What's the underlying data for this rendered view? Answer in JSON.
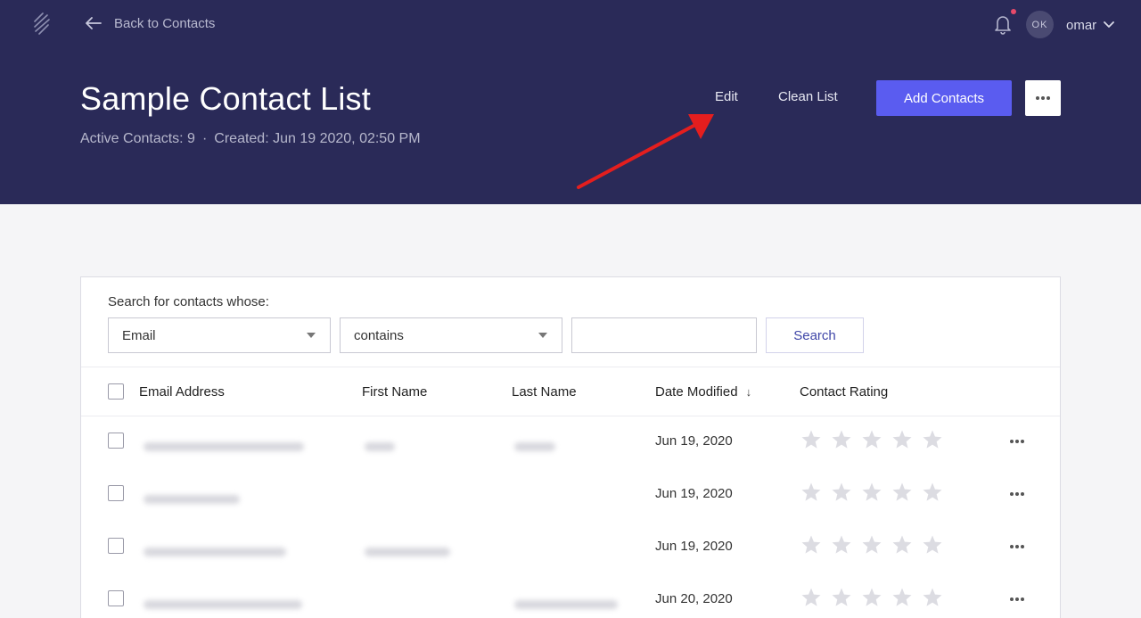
{
  "nav": {
    "back_label": "Back to Contacts",
    "avatar_initials": "OK",
    "username": "omar",
    "has_notification": true
  },
  "list": {
    "title": "Sample Contact List",
    "active_contacts": "Active Contacts: 9",
    "separator": "·",
    "created": "Created: Jun 19 2020, 02:50 PM"
  },
  "actions": {
    "edit_label": "Edit",
    "clean_label": "Clean List",
    "add_label": "Add Contacts"
  },
  "search": {
    "label": "Search for contacts whose:",
    "field_value": "Email",
    "operator_value": "contains",
    "query_value": "",
    "button_label": "Search"
  },
  "table": {
    "columns": [
      "Email Address",
      "First Name",
      "Last Name",
      "Date Modified",
      "Contact Rating"
    ],
    "sort_indicator": "↓",
    "rows": [
      {
        "date": "Jun 19, 2020",
        "rating": 0
      },
      {
        "date": "Jun 19, 2020",
        "rating": 0
      },
      {
        "date": "Jun 19, 2020",
        "rating": 0
      },
      {
        "date": "Jun 20, 2020",
        "rating": 0
      }
    ]
  },
  "colors": {
    "header_bg": "#2a2a58",
    "primary": "#5a5cf0",
    "annotation_arrow": "#e41e1e",
    "star_empty": "#dcdce2"
  }
}
